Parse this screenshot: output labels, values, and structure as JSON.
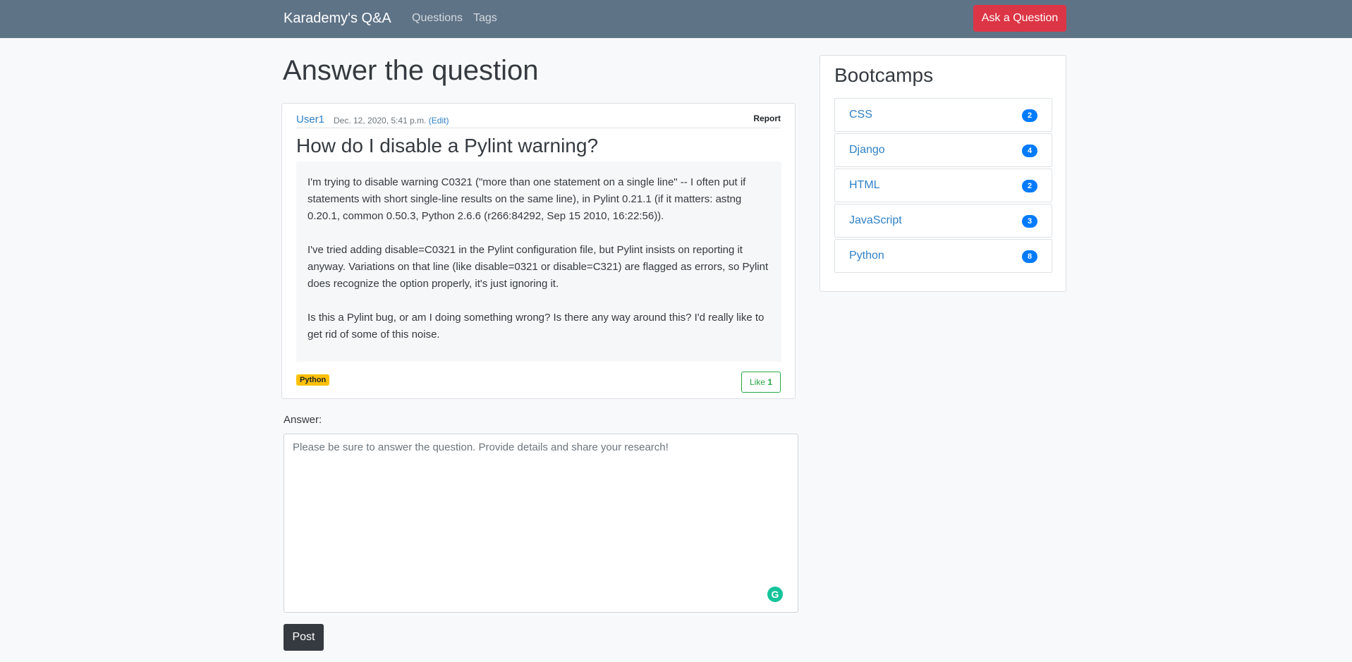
{
  "navbar": {
    "brand": "Karademy's Q&A",
    "links": [
      "Questions",
      "Tags"
    ],
    "ask_button": "Ask a Question"
  },
  "page": {
    "title": "Answer the question"
  },
  "question": {
    "author": "User1",
    "date": "Dec. 12, 2020, 5:41 p.m.",
    "edit_label": "(Edit)",
    "report_label": "Report",
    "title": "How do I disable a Pylint warning?",
    "body": [
      "I'm trying to disable warning C0321 (\"more than one statement on a single line\" -- I often put if statements with short single-line results on the same line), in Pylint 0.21.1 (if it matters: astng 0.20.1, common 0.50.3, Python 2.6.6 (r266:84292, Sep 15 2010, 16:22:56)).",
      "I've tried adding disable=C0321 in the Pylint configuration file, but Pylint insists on reporting it anyway. Variations on that line (like disable=0321 or disable=C321) are flagged as errors, so Pylint does recognize the option properly, it's just ignoring it.",
      "Is this a Pylint bug, or am I doing something wrong? Is there any way around this? I'd really like to get rid of some of this noise."
    ],
    "tag": "Python",
    "like_label": "Like",
    "like_count": "1"
  },
  "answer": {
    "label": "Answer:",
    "placeholder": "Please be sure to answer the question. Provide details and share your research!",
    "value": "",
    "post_button": "Post"
  },
  "sidebar": {
    "title": "Bootcamps",
    "items": [
      {
        "label": "CSS",
        "count": "2"
      },
      {
        "label": "Django",
        "count": "4"
      },
      {
        "label": "HTML",
        "count": "2"
      },
      {
        "label": "JavaScript",
        "count": "3"
      },
      {
        "label": "Python",
        "count": "8"
      }
    ]
  },
  "colors": {
    "navbar": "#5f7387",
    "danger": "#dc3545",
    "link": "#2f80c7",
    "badge": "#007bff",
    "tag": "#ffc107",
    "success": "#28a745",
    "dark": "#343a40"
  },
  "icons": {
    "grammarly": "grammarly-icon"
  }
}
